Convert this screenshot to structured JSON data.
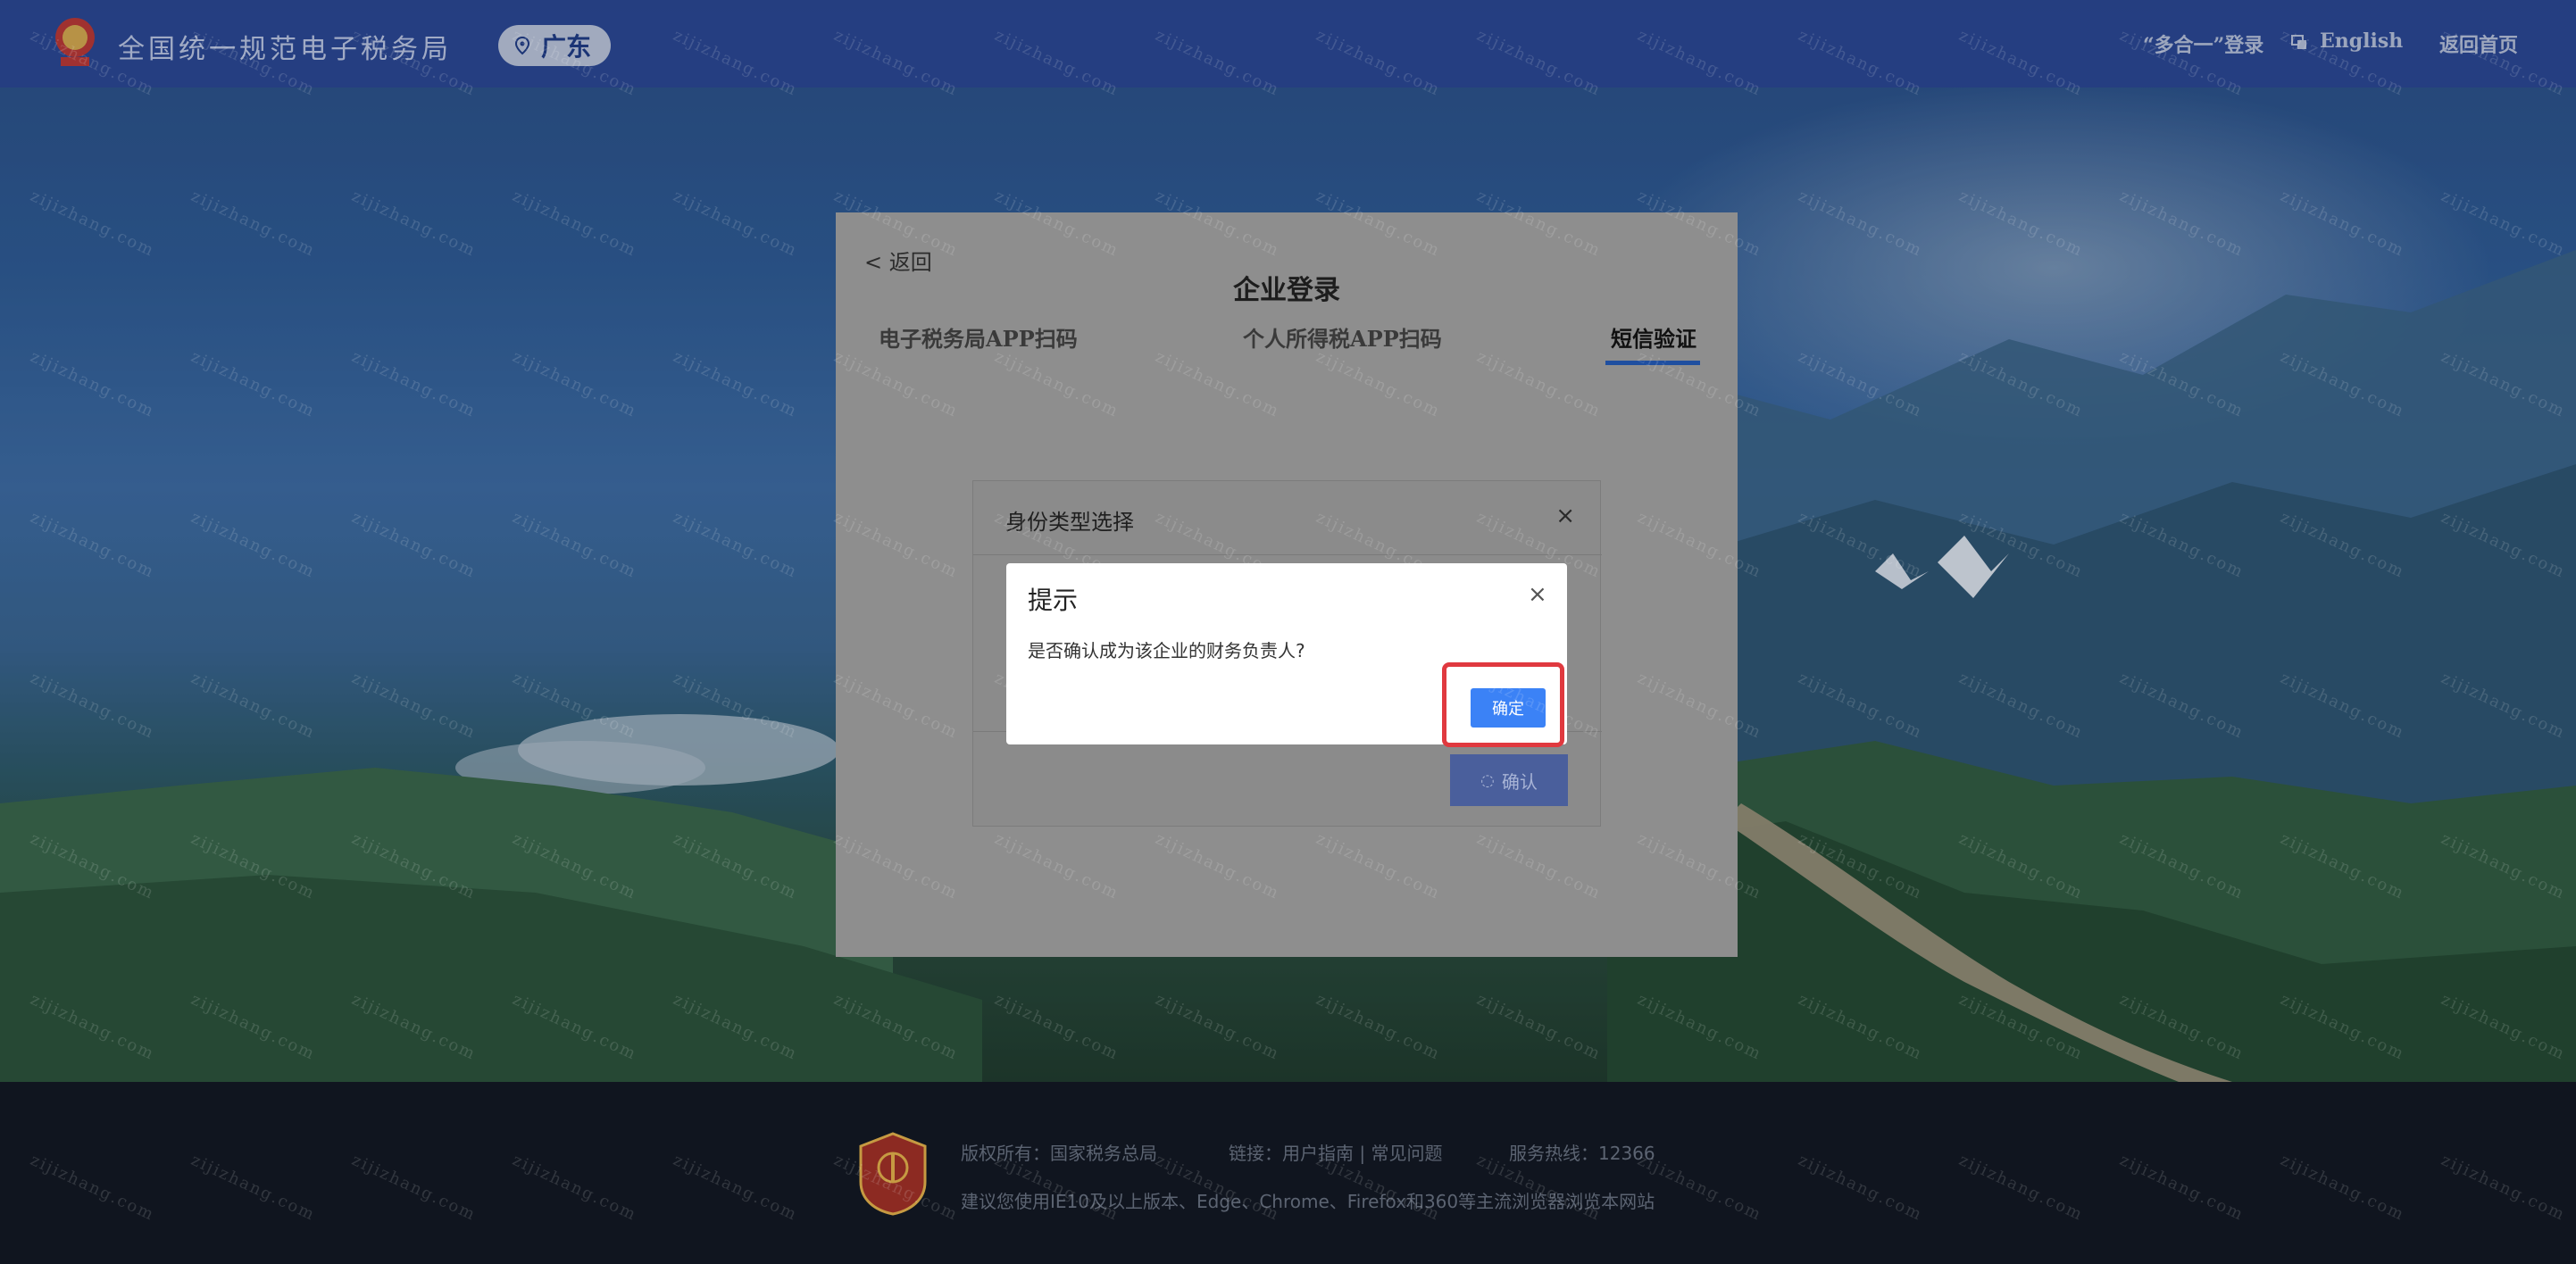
{
  "header": {
    "site_title": "全国统一规范电子税务局",
    "region": "广东",
    "multi_login": "“多合一”登录",
    "language": "English",
    "home": "返回首页"
  },
  "panel": {
    "back": "< 返回",
    "title": "企业登录",
    "tabs": [
      "电子税务局APP扫码",
      "个人所得税APP扫码",
      "短信验证"
    ],
    "active_tab": "短信验证"
  },
  "identity_dialog": {
    "title": "身份类型选择",
    "close": "×",
    "confirm_label": "确认",
    "loading_icon": "loading-spinner-icon"
  },
  "prompt_dialog": {
    "title": "提示",
    "close": "×",
    "message": "是否确认成为该企业的财务负责人?",
    "ok_label": "确定"
  },
  "footer": {
    "copyright": "版权所有：国家税务总局",
    "links": "链接：用户指南 | 常见问题",
    "hotline": "服务热线：12366",
    "browser_tip": "建议您使用IE10及以上版本、Edge、Chrome、Firefox和360等主流浏览器浏览本网站"
  },
  "colors": {
    "header_bg": "#2b4696",
    "primary_button": "#3b82f6",
    "highlight": "#e0393f",
    "footer_bg": "#10151f"
  },
  "watermark_text": "zijizhang.com"
}
